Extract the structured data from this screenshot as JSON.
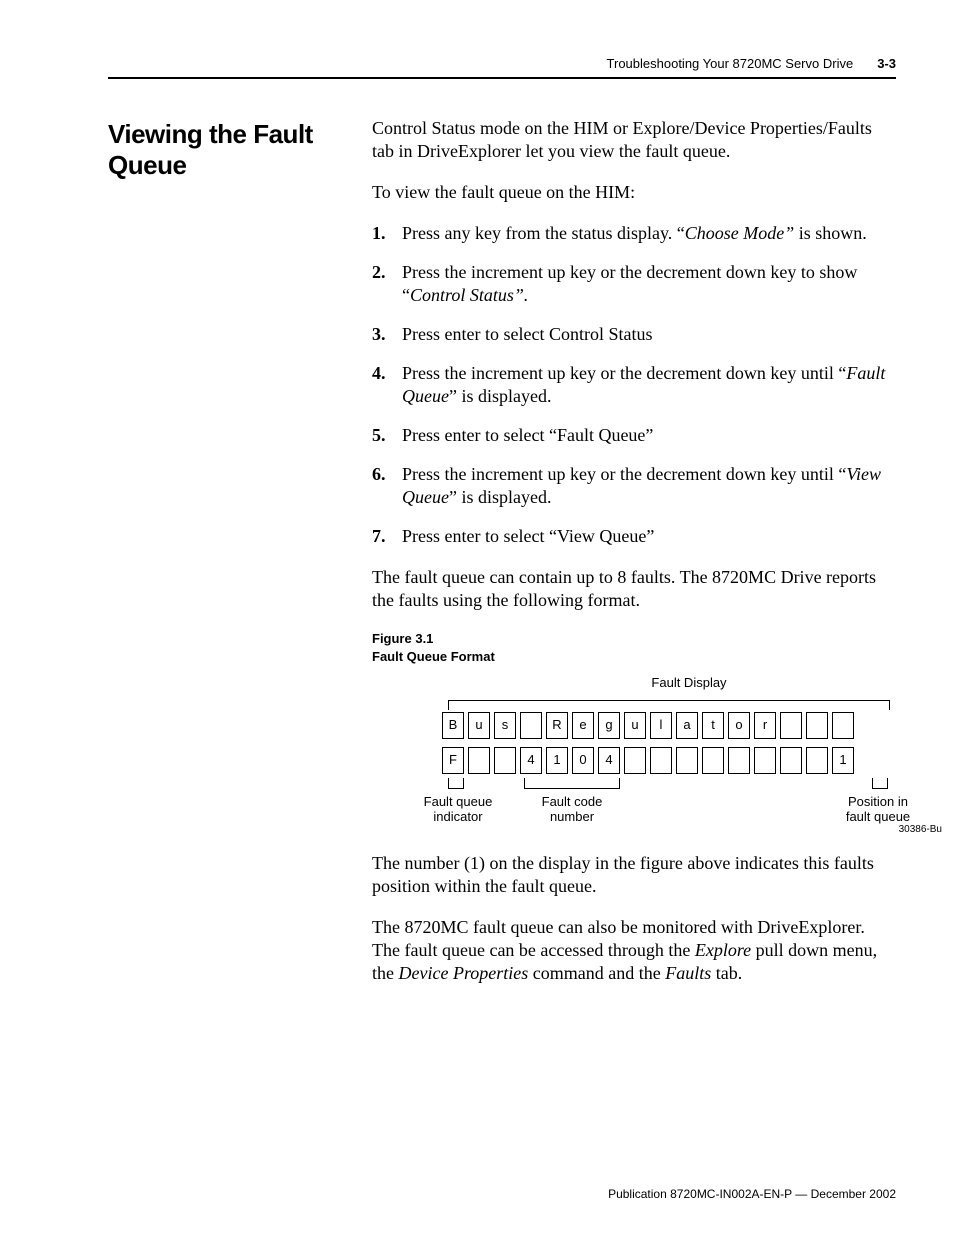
{
  "header": {
    "title": "Troubleshooting Your 8720MC Servo Drive",
    "page": "3-3"
  },
  "section": {
    "title": "Viewing the Fault Queue"
  },
  "body": {
    "intro": "Control Status mode on the HIM or Explore/Device Properties/Faults tab in DriveExplorer let you view the fault queue.",
    "lead": "To view the fault queue on the HIM:",
    "steps": [
      {
        "pre": "Press any key from the status display. “",
        "em": "Choose Mode”",
        "post": " is shown."
      },
      {
        "pre": "Press the increment up key or the decrement down key to show “",
        "em": "Control Status”.",
        "post": ""
      },
      {
        "pre": "Press enter to select Control Status",
        "em": "",
        "post": ""
      },
      {
        "pre": "Press the increment up key or the decrement down key until “",
        "em": "Fault Queue",
        "post": "” is displayed."
      },
      {
        "pre": "Press enter to select “Fault Queue”",
        "em": "",
        "post": ""
      },
      {
        "pre": "Press the increment up key or the decrement down key until “",
        "em": "View Queue",
        "post": "” is displayed."
      },
      {
        "pre": "Press enter to select  “View Queue”",
        "em": "",
        "post": ""
      }
    ],
    "afterSteps": "The fault queue can contain up to 8 faults. The 8720MC Drive reports the faults using the following format.",
    "figCaption1": "Figure 3.1",
    "figCaption2": "Fault Queue Format",
    "figure": {
      "topLabel": "Fault Display",
      "row1": [
        "B",
        "u",
        "s",
        "",
        "R",
        "e",
        "g",
        "u",
        "l",
        "a",
        "t",
        "o",
        "r",
        "",
        "",
        ""
      ],
      "row2": [
        "F",
        "",
        "",
        "4",
        "1",
        "0",
        "4",
        "",
        "",
        "",
        "",
        "",
        "",
        "",
        "",
        "1"
      ],
      "bl1a": "Fault queue",
      "bl1b": "indicator",
      "bl2a": "Fault code",
      "bl2b": "number",
      "bl3a": "Position in",
      "bl3b": "fault queue",
      "id": "30386-Bu"
    },
    "afterFig1": "The number (1) on the display in the figure above indicates this faults position within the fault queue.",
    "afterFig2_a": "The 8720MC fault queue can also be monitored with DriveExplorer. The fault queue can be accessed through the ",
    "afterFig2_em1": "Explore",
    "afterFig2_b": " pull down menu, the ",
    "afterFig2_em2": "Device Properties",
    "afterFig2_c": " command and the ",
    "afterFig2_em3": "Faults",
    "afterFig2_d": " tab."
  },
  "footer": {
    "pub": "Publication 8720MC-IN002A-EN-P — December 2002"
  }
}
